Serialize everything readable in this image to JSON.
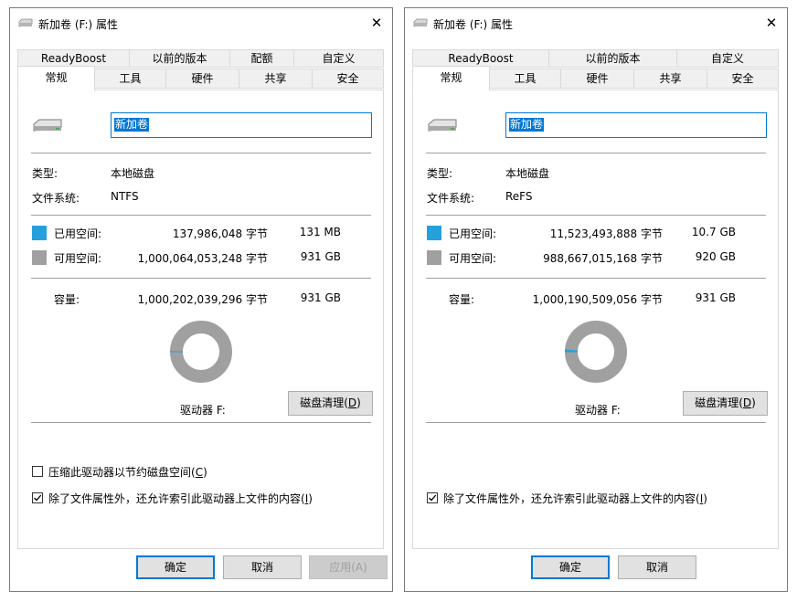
{
  "colors": {
    "used": "#26a0da",
    "free": "#a0a0a0",
    "accent": "#0078d7"
  },
  "dialogs": [
    {
      "title": "新加卷 (F:) 属性",
      "tabs_row1": [
        "ReadyBoost",
        "以前的版本",
        "配额",
        "自定义"
      ],
      "tabs_row2": [
        "常规",
        "工具",
        "硬件",
        "共享",
        "安全"
      ],
      "active_tab": "常规",
      "volume_name": "新加卷",
      "type_label": "类型:",
      "type_value": "本地磁盘",
      "fs_label": "文件系统:",
      "fs_value": "NTFS",
      "used_label": "已用空间:",
      "used_bytes": "137,986,048 字节",
      "used_size": "131 MB",
      "free_label": "可用空间:",
      "free_bytes": "1,000,064,053,248 字节",
      "free_size": "931 GB",
      "cap_label": "容量:",
      "cap_bytes": "1,000,202,039,296 字节",
      "cap_size": "931 GB",
      "used_fraction": 0.000138,
      "drive_label": "驱动器 F:",
      "cleanup_text": "磁盘清理(",
      "cleanup_key": "D",
      "cleanup_end": ")",
      "compress_text": "压缩此驱动器以节约磁盘空间(",
      "compress_key": "C",
      "compress_end": ")",
      "compress_visible": true,
      "compress_checked": false,
      "index_text": "除了文件属性外，还允许索引此驱动器上文件的内容(",
      "index_key": "I",
      "index_end": ")",
      "index_checked": true,
      "ok": "确定",
      "cancel": "取消",
      "apply": "应用(A)"
    },
    {
      "title": "新加卷 (F:) 属性",
      "tabs_row1": [
        "ReadyBoost",
        "以前的版本",
        "自定义"
      ],
      "tabs_row2": [
        "常规",
        "工具",
        "硬件",
        "共享",
        "安全"
      ],
      "active_tab": "常规",
      "volume_name": "新加卷",
      "type_label": "类型:",
      "type_value": "本地磁盘",
      "fs_label": "文件系统:",
      "fs_value": "ReFS",
      "used_label": "已用空间:",
      "used_bytes": "11,523,493,888 字节",
      "used_size": "10.7 GB",
      "free_label": "可用空间:",
      "free_bytes": "988,667,015,168 字节",
      "free_size": "920 GB",
      "cap_label": "容量:",
      "cap_bytes": "1,000,190,509,056 字节",
      "cap_size": "931 GB",
      "used_fraction": 0.0115,
      "drive_label": "驱动器 F:",
      "cleanup_text": "磁盘清理(",
      "cleanup_key": "D",
      "cleanup_end": ")",
      "compress_visible": false,
      "index_text": "除了文件属性外，还允许索引此驱动器上文件的内容(",
      "index_key": "I",
      "index_end": ")",
      "index_checked": true,
      "ok": "确定",
      "cancel": "取消"
    }
  ]
}
